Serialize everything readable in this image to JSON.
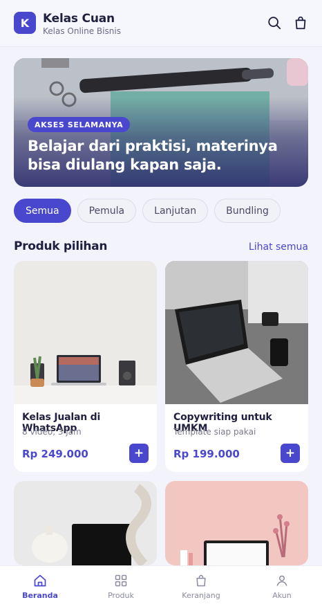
{
  "header": {
    "logo_letter": "K",
    "app_name": "Kelas Cuan",
    "app_subtitle": "Kelas Online Bisnis",
    "icons": [
      "search-icon",
      "shopping-bag-icon"
    ]
  },
  "hero": {
    "badge": "AKSES SELAMANYA",
    "title": "Belajar dari praktisi, materinya bisa diulang kapan saja."
  },
  "filters": {
    "chips": [
      {
        "label": "Semua",
        "active": true
      },
      {
        "label": "Pemula",
        "active": false
      },
      {
        "label": "Lanjutan",
        "active": false
      },
      {
        "label": "Bundling",
        "active": false
      }
    ]
  },
  "section": {
    "title": "Produk pilihan",
    "link": "Lihat semua"
  },
  "products": [
    {
      "title": "Kelas Jualan di WhatsApp",
      "subtitle": "8 video, 3 jam",
      "price": "Rp 249.000",
      "add": "+"
    },
    {
      "title": "Copywriting untuk UMKM",
      "subtitle": "Template siap pakai",
      "price": "Rp 199.000",
      "add": "+"
    },
    {
      "title": "",
      "subtitle": "",
      "price": "",
      "add": ""
    },
    {
      "title": "",
      "subtitle": "",
      "price": "",
      "add": ""
    }
  ],
  "bottom_nav": [
    {
      "label": "Beranda",
      "icon": "home-icon",
      "active": true
    },
    {
      "label": "Produk",
      "icon": "grid-icon",
      "active": false
    },
    {
      "label": "Keranjang",
      "icon": "bag-icon",
      "active": false
    },
    {
      "label": "Akun",
      "icon": "user-icon",
      "active": false
    }
  ],
  "colors": {
    "accent": "#4a47cf",
    "background": "#f3f3fb",
    "text": "#1f1f3f"
  }
}
